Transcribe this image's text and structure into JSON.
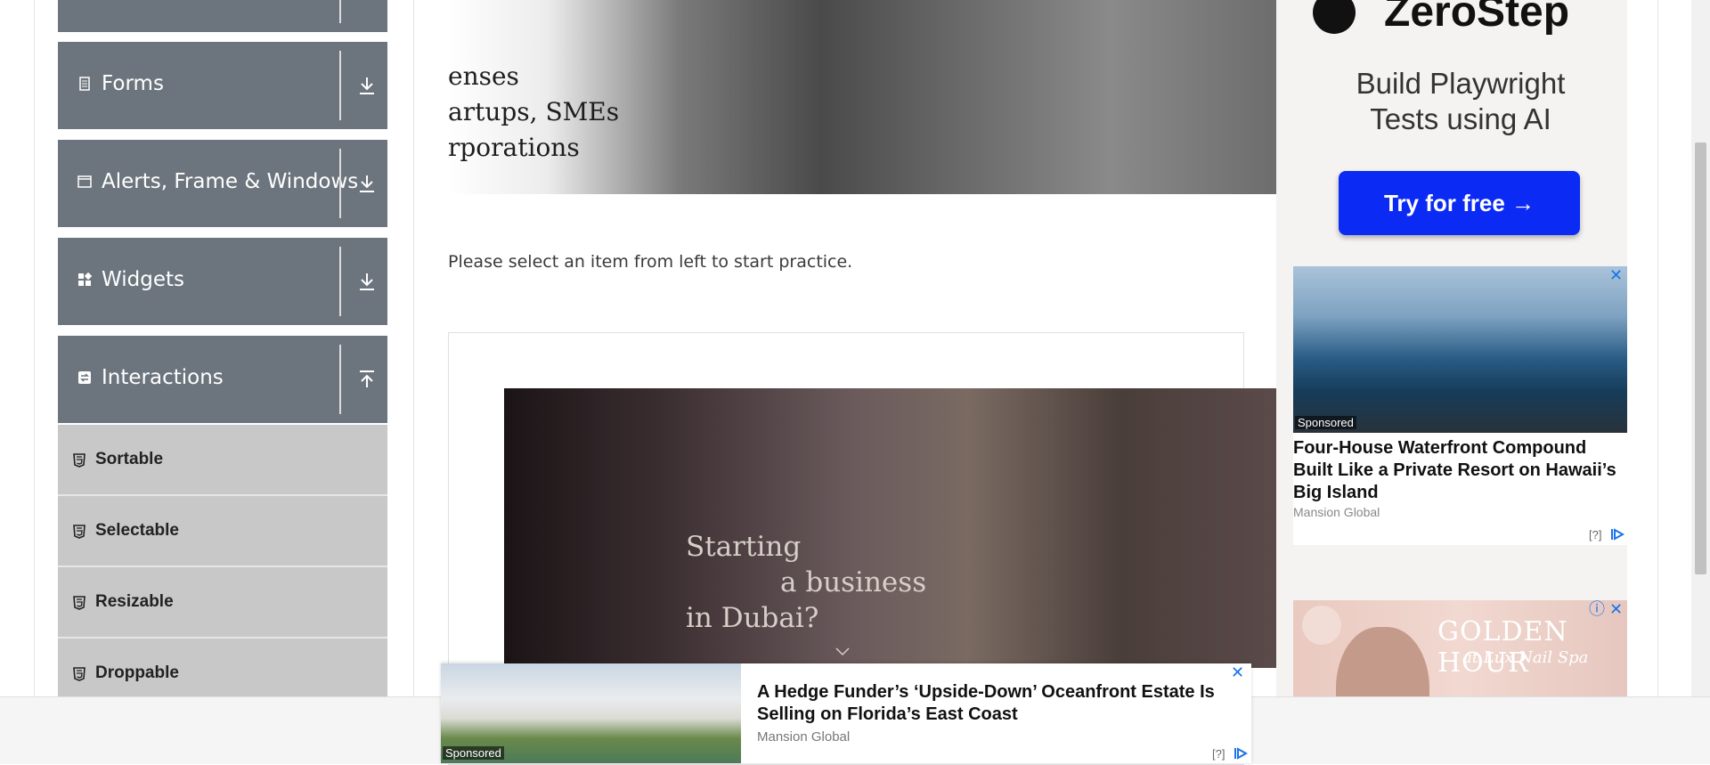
{
  "sidebar": {
    "groups": [
      {
        "label": "Forms",
        "icon": "form-icon",
        "arrow": "download-arrow-icon"
      },
      {
        "label": "Alerts, Frame & Windows",
        "icon": "window-icon",
        "arrow": "download-arrow-icon"
      },
      {
        "label": "Widgets",
        "icon": "widgets-icon",
        "arrow": "download-arrow-icon"
      },
      {
        "label": "Interactions",
        "icon": "interactions-icon",
        "arrow": "upload-arrow-icon"
      }
    ],
    "items": [
      {
        "label": "Sortable"
      },
      {
        "label": "Selectable"
      },
      {
        "label": "Resizable"
      },
      {
        "label": "Droppable"
      }
    ]
  },
  "main": {
    "banner_top_lines": [
      "enses",
      "artups, SMEs",
      "rporations"
    ],
    "intro_text": "Please select an item from left to start practice.",
    "banner_lines": [
      "Starting",
      "a business",
      "in Dubai?"
    ]
  },
  "right_ad": {
    "logo": "ZeroStep",
    "headline_line1": "Build Playwright",
    "headline_line2": "Tests using AI",
    "button_label": "Try for free →",
    "button_color": "#0b2bf5"
  },
  "card_ad": {
    "sponsored": "Sponsored",
    "title": "Four-House Waterfront Compound Built Like a Private Resort on Hawaii’s Big Island",
    "source": "Mansion Global",
    "adchoice": "[?]"
  },
  "golden_ad": {
    "title": "GOLDEN HOUR",
    "subtitle": "at Lux Nail Spa"
  },
  "bottom_ad": {
    "sponsored": "Sponsored",
    "title": "A Hedge Funder’s ‘Upside-Down’ Oceanfront Estate Is Selling on Florida’s East Coast",
    "source": "Mansion Global",
    "adchoice": "[?]"
  }
}
